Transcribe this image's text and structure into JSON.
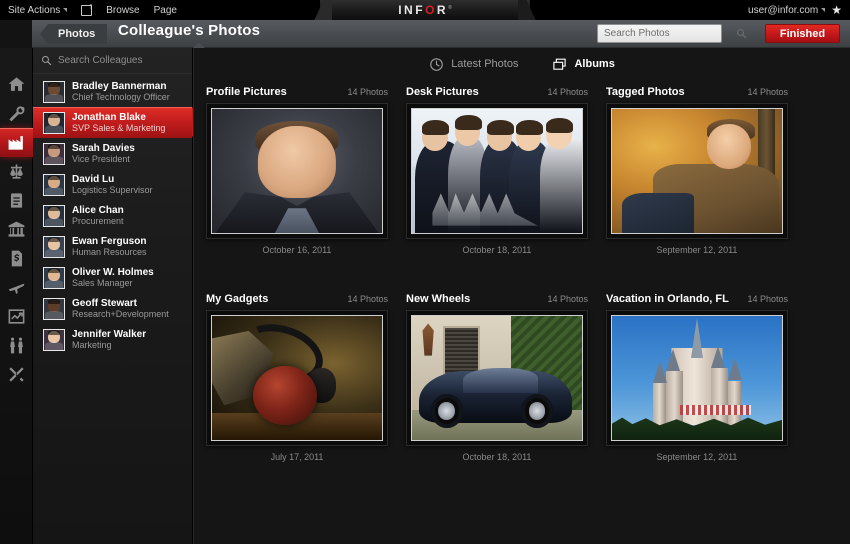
{
  "global_bar": {
    "site_actions": "Site Actions",
    "nav_icon": "navigate-up-icon",
    "browse": "Browse",
    "page": "Page",
    "logo": {
      "text_before": "INF",
      "text_o": "O",
      "text_after": "R",
      "tm": "®"
    },
    "user": "user@infor.com",
    "star_icon": "star-icon"
  },
  "ribbon": {
    "breadcrumb": "Photos",
    "title": "Colleague's Photos",
    "search": {
      "placeholder": "Search Photos",
      "value": "",
      "icon": "search-icon"
    },
    "finished_button": "Finished"
  },
  "rail": {
    "items": [
      {
        "icon": "home-icon",
        "active": false
      },
      {
        "icon": "wrench-machine-icon",
        "active": false
      },
      {
        "icon": "factory-icon",
        "active": true
      },
      {
        "icon": "scales-icon",
        "active": false
      },
      {
        "icon": "clipboard-icon",
        "active": false
      },
      {
        "icon": "bank-icon",
        "active": false
      },
      {
        "icon": "invoice-dollar-icon",
        "active": false
      },
      {
        "icon": "airplane-icon",
        "active": false
      },
      {
        "icon": "chart-icon",
        "active": false
      },
      {
        "icon": "people-icon",
        "active": false
      },
      {
        "icon": "tools-icon",
        "active": false
      }
    ]
  },
  "sidebar": {
    "search": {
      "placeholder": "Search Colleagues",
      "value": "",
      "icon": "search-icon"
    },
    "colleagues": [
      {
        "name": "Bradley Bannerman",
        "role": "Chief Technology Officer",
        "selected": false
      },
      {
        "name": "Jonathan Blake",
        "role": "SVP Sales & Marketing",
        "selected": true
      },
      {
        "name": "Sarah Davies",
        "role": "Vice President",
        "selected": false
      },
      {
        "name": "David Lu",
        "role": "Logistics Supervisor",
        "selected": false
      },
      {
        "name": "Alice Chan",
        "role": "Procurement",
        "selected": false
      },
      {
        "name": "Ewan Ferguson",
        "role": "Human Resources",
        "selected": false
      },
      {
        "name": "Oliver W. Holmes",
        "role": "Sales Manager",
        "selected": false
      },
      {
        "name": "Geoff Stewart",
        "role": "Research+Development",
        "selected": false
      },
      {
        "name": "Jennifer Walker",
        "role": "Marketing",
        "selected": false
      }
    ]
  },
  "main": {
    "view_tabs": [
      {
        "label": "Latest Photos",
        "icon": "clock-icon",
        "active": false
      },
      {
        "label": "Albums",
        "icon": "albums-icon",
        "active": true
      }
    ],
    "albums": [
      {
        "title": "Profile Pictures",
        "count": "14 Photos",
        "date": "October 16, 2011",
        "art": "ph-profile"
      },
      {
        "title": "Desk Pictures",
        "count": "14 Photos",
        "date": "October 18, 2011",
        "art": "ph-desk"
      },
      {
        "title": "Tagged Photos",
        "count": "14 Photos",
        "date": "September 12, 2011",
        "art": "ph-tagged"
      },
      {
        "title": "My Gadgets",
        "count": "14 Photos",
        "date": "July 17, 2011",
        "art": "ph-gadget"
      },
      {
        "title": "New Wheels",
        "count": "14 Photos",
        "date": "October 18, 2011",
        "art": "ph-wheels"
      },
      {
        "title": "Vacation in Orlando, FL",
        "count": "14 Photos",
        "date": "September 12, 2011",
        "art": "ph-castle"
      }
    ]
  },
  "colors": {
    "accent_red": "#c01c1c",
    "finished_red": "#c3171a",
    "logo_red": "#d61f26",
    "ribbon_grey": "#4a4e52",
    "background": "#151515"
  }
}
